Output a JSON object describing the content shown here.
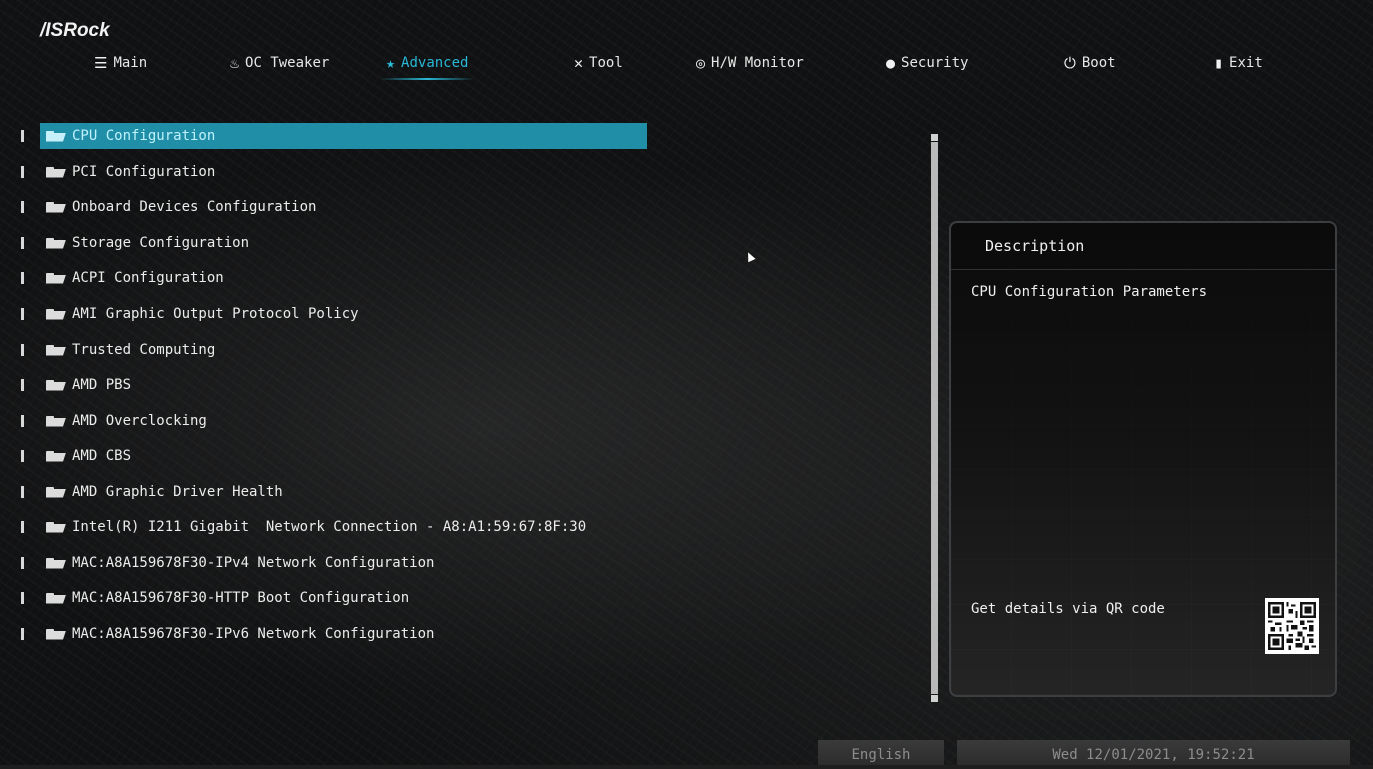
{
  "brand": "/ISRock",
  "tabs": [
    {
      "label": "Main",
      "icon": "list-icon",
      "glyph": "☰",
      "active": false
    },
    {
      "label": "OC Tweaker",
      "icon": "flame-icon",
      "glyph": "♨",
      "active": false
    },
    {
      "label": "Advanced",
      "icon": "star-icon",
      "glyph": "★",
      "active": true
    },
    {
      "label": "Tool",
      "icon": "wrench-icon",
      "glyph": "✕",
      "active": false
    },
    {
      "label": "H/W Monitor",
      "icon": "monitor-icon",
      "glyph": "◎",
      "active": false
    },
    {
      "label": "Security",
      "icon": "shield-icon",
      "glyph": "●",
      "active": false
    },
    {
      "label": "Boot",
      "icon": "power-icon",
      "glyph": "⏻",
      "active": false
    },
    {
      "label": "Exit",
      "icon": "exit-icon",
      "glyph": "▮",
      "active": false
    }
  ],
  "menu": [
    {
      "label": "CPU Configuration",
      "selected": true
    },
    {
      "label": "PCI Configuration"
    },
    {
      "label": "Onboard Devices Configuration"
    },
    {
      "label": "Storage Configuration"
    },
    {
      "label": "ACPI Configuration"
    },
    {
      "label": "AMI Graphic Output Protocol Policy"
    },
    {
      "label": "Trusted Computing"
    },
    {
      "label": "AMD PBS"
    },
    {
      "label": "AMD Overclocking"
    },
    {
      "label": "AMD CBS"
    },
    {
      "label": "AMD Graphic Driver Health"
    },
    {
      "label": "Intel(R) I211 Gigabit  Network Connection - A8:A1:59:67:8F:30"
    },
    {
      "label": "MAC:A8A159678F30-IPv4 Network Configuration"
    },
    {
      "label": "MAC:A8A159678F30-HTTP Boot Configuration"
    },
    {
      "label": "MAC:A8A159678F30-IPv6 Network Configuration"
    }
  ],
  "description": {
    "heading": "Description",
    "text": "CPU Configuration Parameters",
    "qr_text": "Get details via QR code"
  },
  "footer": {
    "language": "English",
    "datetime": "Wed 12/01/2021, 19:52:21"
  },
  "colors": {
    "accent": "#29b8d6",
    "selection": "#1f8ea6"
  }
}
